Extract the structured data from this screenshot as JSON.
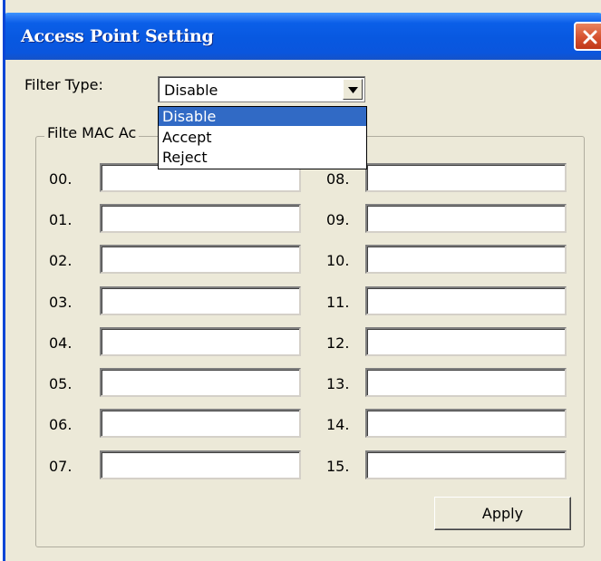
{
  "window": {
    "title": "Access Point Setting",
    "close_icon": "close-icon"
  },
  "filter": {
    "label": "Filter Type:",
    "value": "Disable",
    "options": [
      "Disable",
      "Accept",
      "Reject"
    ],
    "selected_index": 0
  },
  "group": {
    "label": "Filte MAC Ac"
  },
  "mac_left": [
    "00.",
    "01.",
    "02.",
    "03.",
    "04.",
    "05.",
    "06.",
    "07."
  ],
  "mac_right": [
    "08.",
    "09.",
    "10.",
    "11.",
    "12.",
    "13.",
    "14.",
    "15."
  ],
  "buttons": {
    "apply": "Apply"
  },
  "colors": {
    "titlebar": "#0858e0",
    "selection": "#316ac5",
    "face": "#ece9d8",
    "close": "#d65230"
  }
}
